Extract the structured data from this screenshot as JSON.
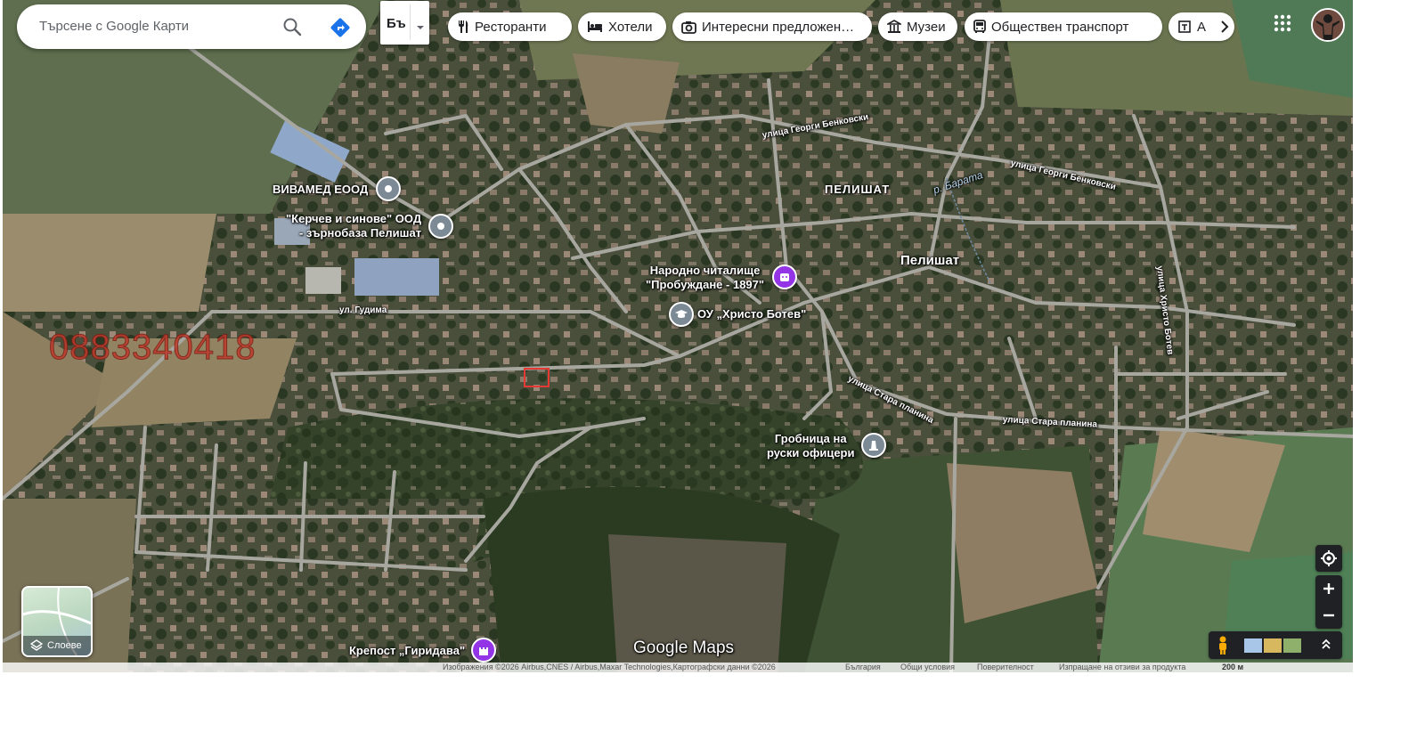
{
  "search": {
    "placeholder": "Търсене с Google Карти"
  },
  "language_button": {
    "label": "Бъ"
  },
  "categories": [
    {
      "label": "Ресторанти",
      "icon": "fork-knife-icon"
    },
    {
      "label": "Хотели",
      "icon": "bed-icon"
    },
    {
      "label": "Интересни предложен…",
      "icon": "camera-icon"
    },
    {
      "label": "Музеи",
      "icon": "museum-icon"
    },
    {
      "label": "Обществен транспорт",
      "icon": "bus-icon"
    },
    {
      "label": "А",
      "icon": "atm-icon"
    }
  ],
  "places": {
    "vivamed": "ВИВАМЕД ЕООД",
    "kerchev_line1": "\"Керчев и синове\" ООД",
    "kerchev_line2": "- зърнобаза Пелишат",
    "chitalishte_line1": "Народно читалище",
    "chitalishte_line2": "\"Пробуждане - 1897\"",
    "school": "ОУ „Христо Ботев\"",
    "tomb_line1": "Гробница на",
    "tomb_line2": "руски офицери",
    "fortress": "Крепост „Гиридава\""
  },
  "town_labels": {
    "upper": "ПЕЛИШАТ",
    "main": "Пелишат",
    "river": "р. Барата"
  },
  "streets": {
    "gudima": "ул. Гудима",
    "benkovski_1": "улица Георги Бенковски",
    "benkovski_2": "улица Георги Бенковски",
    "hristo_botev": "улица Христо Ботев",
    "stara_planina_1": "улица Стара планина",
    "stara_planina_2": "улица Стара планина"
  },
  "overlay_phone": "0883340418",
  "layers_button": {
    "label": "Слоеве"
  },
  "brand": "Google Maps",
  "footer": {
    "imagery": "Изображения ©2026 Airbus,CNES / Airbus,Maxar Technologies,Картографски данни ©2026",
    "country": "България",
    "terms": "Общи условия",
    "privacy": "Поверителност",
    "feedback": "Изпращане на отзиви за продукта",
    "scale": "200 м"
  },
  "colors": {
    "directions": "#1a73e8",
    "poi_gray": "#7b8a95",
    "poi_purple": "#9334e6",
    "road": "#a7a7a0",
    "phone_overlay": "#c0392b",
    "marker": "#e53935"
  }
}
